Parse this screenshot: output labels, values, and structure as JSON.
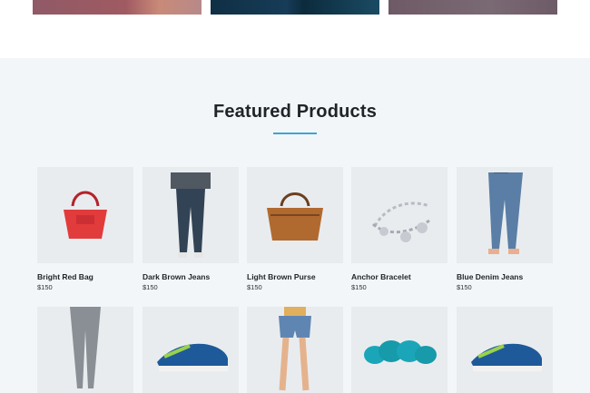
{
  "section": {
    "title": "Featured Products"
  },
  "products_row1": [
    {
      "name": "Bright Red Bag",
      "price": "$150",
      "icon": "red-bag-icon"
    },
    {
      "name": "Dark Brown Jeans",
      "price": "$150",
      "icon": "dark-jeans-icon"
    },
    {
      "name": "Light Brown Purse",
      "price": "$150",
      "icon": "brown-purse-icon"
    },
    {
      "name": "Anchor Bracelet",
      "price": "$150",
      "icon": "bracelet-icon"
    },
    {
      "name": "Blue Denim Jeans",
      "price": "$150",
      "icon": "blue-jeans-icon"
    }
  ],
  "products_row2": [
    {
      "icon": "gray-jeans-icon"
    },
    {
      "icon": "sneakers-icon"
    },
    {
      "icon": "denim-shorts-icon"
    },
    {
      "icon": "turquoise-bracelet-icon"
    },
    {
      "icon": "sneakers-icon"
    }
  ],
  "colors": {
    "accent": "#3aa6d3",
    "section_bg": "#f3f6f9"
  }
}
